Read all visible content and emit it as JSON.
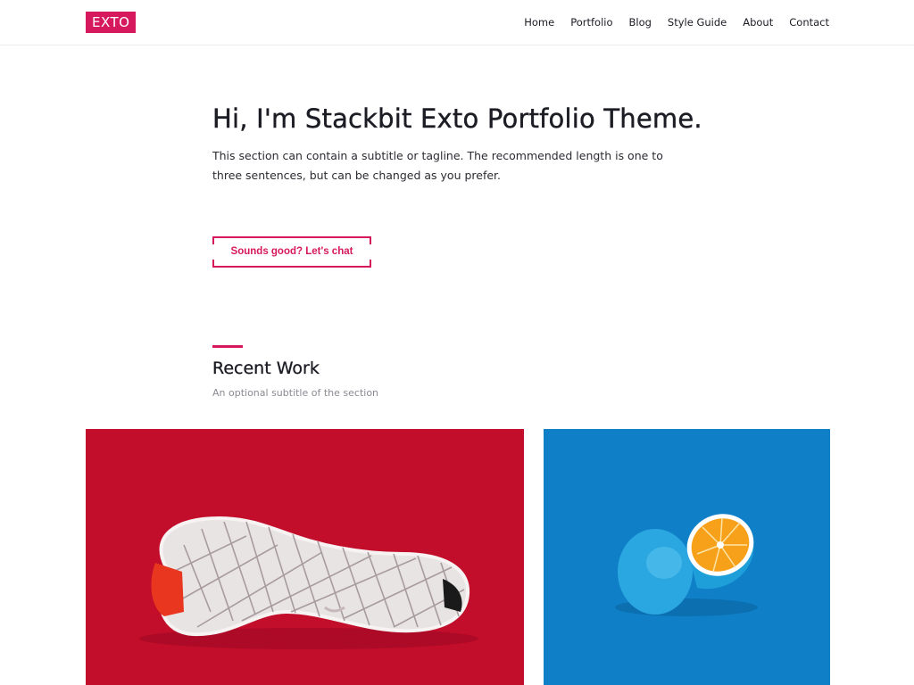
{
  "header": {
    "logo": "EXTO",
    "nav": [
      "Home",
      "Portfolio",
      "Blog",
      "Style Guide",
      "About",
      "Contact"
    ]
  },
  "hero": {
    "title": "Hi, I'm Stackbit Exto Portfolio Theme.",
    "subtitle": "This section can contain a subtitle or tagline. The recommended length is one to three sentences, but can be changed as you prefer.",
    "cta_label": "Sounds good? Let's chat"
  },
  "recent_work": {
    "title": "Recent Work",
    "subtitle": "An optional subtitle of the section",
    "items": [
      {
        "image": "sneaker-sole-on-red"
      },
      {
        "image": "blue-painted-orange-on-blue"
      }
    ]
  },
  "colors": {
    "accent": "#d6185c",
    "text": "#1c1c25",
    "card_red": "#c20d2b",
    "card_blue": "#0f80c8"
  }
}
